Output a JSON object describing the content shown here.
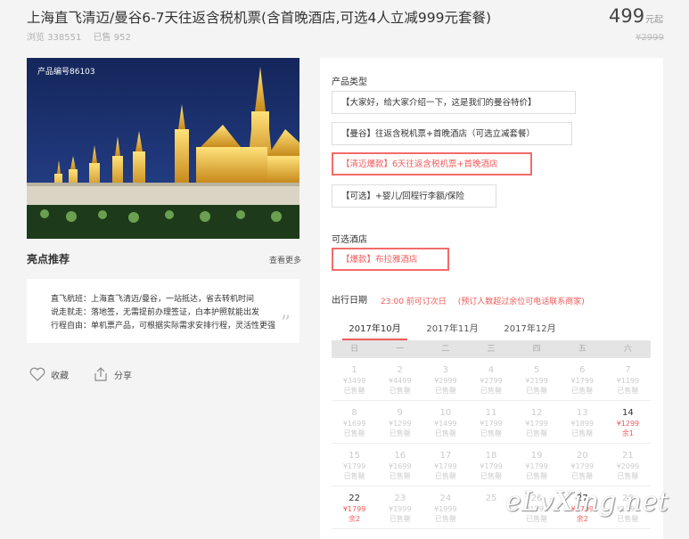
{
  "product": {
    "title": "上海直飞清迈/曼谷6-7天往返含税机票(含首晚酒店,可选4人立减999元套餐)",
    "views": "浏览 338551",
    "sold": "已售 952",
    "price": "499",
    "price_unit": "元起",
    "old_price": "¥2999"
  },
  "gallery": {
    "product_number": "产品编号86103"
  },
  "highlights": {
    "title": "亮点推荐",
    "more": "查看更多",
    "lines": [
      "直飞航班：上海直飞清迈/曼谷，一站抵达，省去转机时间",
      "说走就走：落地签，无需提前办理签证，白本护照就能出发",
      "行程自由：单机票产品，可根据实际需求安排行程，灵活性更强"
    ],
    "quote_icon": "quote-icon"
  },
  "actions": {
    "favorite": "收藏",
    "share": "分享"
  },
  "options": {
    "product_type_label": "产品类型",
    "product_types": [
      "【大家好，给大家介绍一下，这是我们的曼谷特价】",
      "【曼谷】往返含税机票+首晚酒店（可选立减套餐）",
      "【清迈爆款】6天往返含税机票+首晚酒店",
      "【可选】+婴儿/回程行李额/保险"
    ],
    "hotel_label": "可选酒店",
    "hotels": [
      "【爆款】布拉雅酒店"
    ],
    "date_label": "出行日期",
    "date_note_1": "23:00 前可订次日",
    "date_note_2": "(预订人数超过余位可电话联系商家)",
    "selected_color": "#f25a5a"
  },
  "calendar": {
    "months": [
      "2017年10月",
      "2017年11月",
      "2017年12月"
    ],
    "active_month": 0,
    "weekdays": [
      "日",
      "一",
      "二",
      "三",
      "四",
      "五",
      "六"
    ],
    "weeks": [
      [
        {
          "day": "1",
          "price": "¥3499",
          "status": "已售罄"
        },
        {
          "day": "2",
          "price": "¥4499",
          "status": "已售罄"
        },
        {
          "day": "3",
          "price": "¥2999",
          "status": "已售罄"
        },
        {
          "day": "4",
          "price": "¥2799",
          "status": "已售罄"
        },
        {
          "day": "5",
          "price": "¥2199",
          "status": "已售罄"
        },
        {
          "day": "6",
          "price": "¥1799",
          "status": "已售罄"
        },
        {
          "day": "7",
          "price": "¥1199",
          "status": "已售罄"
        }
      ],
      [
        {
          "day": "8",
          "price": "¥1699",
          "status": "已售罄"
        },
        {
          "day": "9",
          "price": "¥1299",
          "status": "已售罄"
        },
        {
          "day": "10",
          "price": "¥1499",
          "status": "已售罄"
        },
        {
          "day": "11",
          "price": "¥1799",
          "status": "已售罄"
        },
        {
          "day": "12",
          "price": "¥1799",
          "status": "已售罄"
        },
        {
          "day": "13",
          "price": "¥1899",
          "status": "已售罄"
        },
        {
          "day": "14",
          "price": "¥1299",
          "status": "余1",
          "available": true
        }
      ],
      [
        {
          "day": "15",
          "price": "¥1799",
          "status": "已售罄"
        },
        {
          "day": "16",
          "price": "¥1699",
          "status": "已售罄"
        },
        {
          "day": "17",
          "price": "¥1799",
          "status": "已售罄"
        },
        {
          "day": "18",
          "price": "¥1799",
          "status": "已售罄"
        },
        {
          "day": "19",
          "price": "¥1799",
          "status": "已售罄"
        },
        {
          "day": "20",
          "price": "¥1799",
          "status": "已售罄"
        },
        {
          "day": "21",
          "price": "¥2099",
          "status": "已售罄"
        }
      ],
      [
        {
          "day": "22",
          "price": "¥1799",
          "status": "余2",
          "available": true
        },
        {
          "day": "23",
          "price": "¥1999",
          "status": "已售罄"
        },
        {
          "day": "24",
          "price": "¥1999",
          "status": "已售罄"
        },
        {
          "day": "25",
          "price": "",
          "status": ""
        },
        {
          "day": "26",
          "price": "¥1799",
          "status": "已售罄"
        },
        {
          "day": "27",
          "price": "¥1799",
          "status": "余2",
          "available": true
        },
        {
          "day": "28",
          "price": "¥1799",
          "status": "已售罄"
        }
      ]
    ]
  },
  "watermark": "eLvXing.net"
}
